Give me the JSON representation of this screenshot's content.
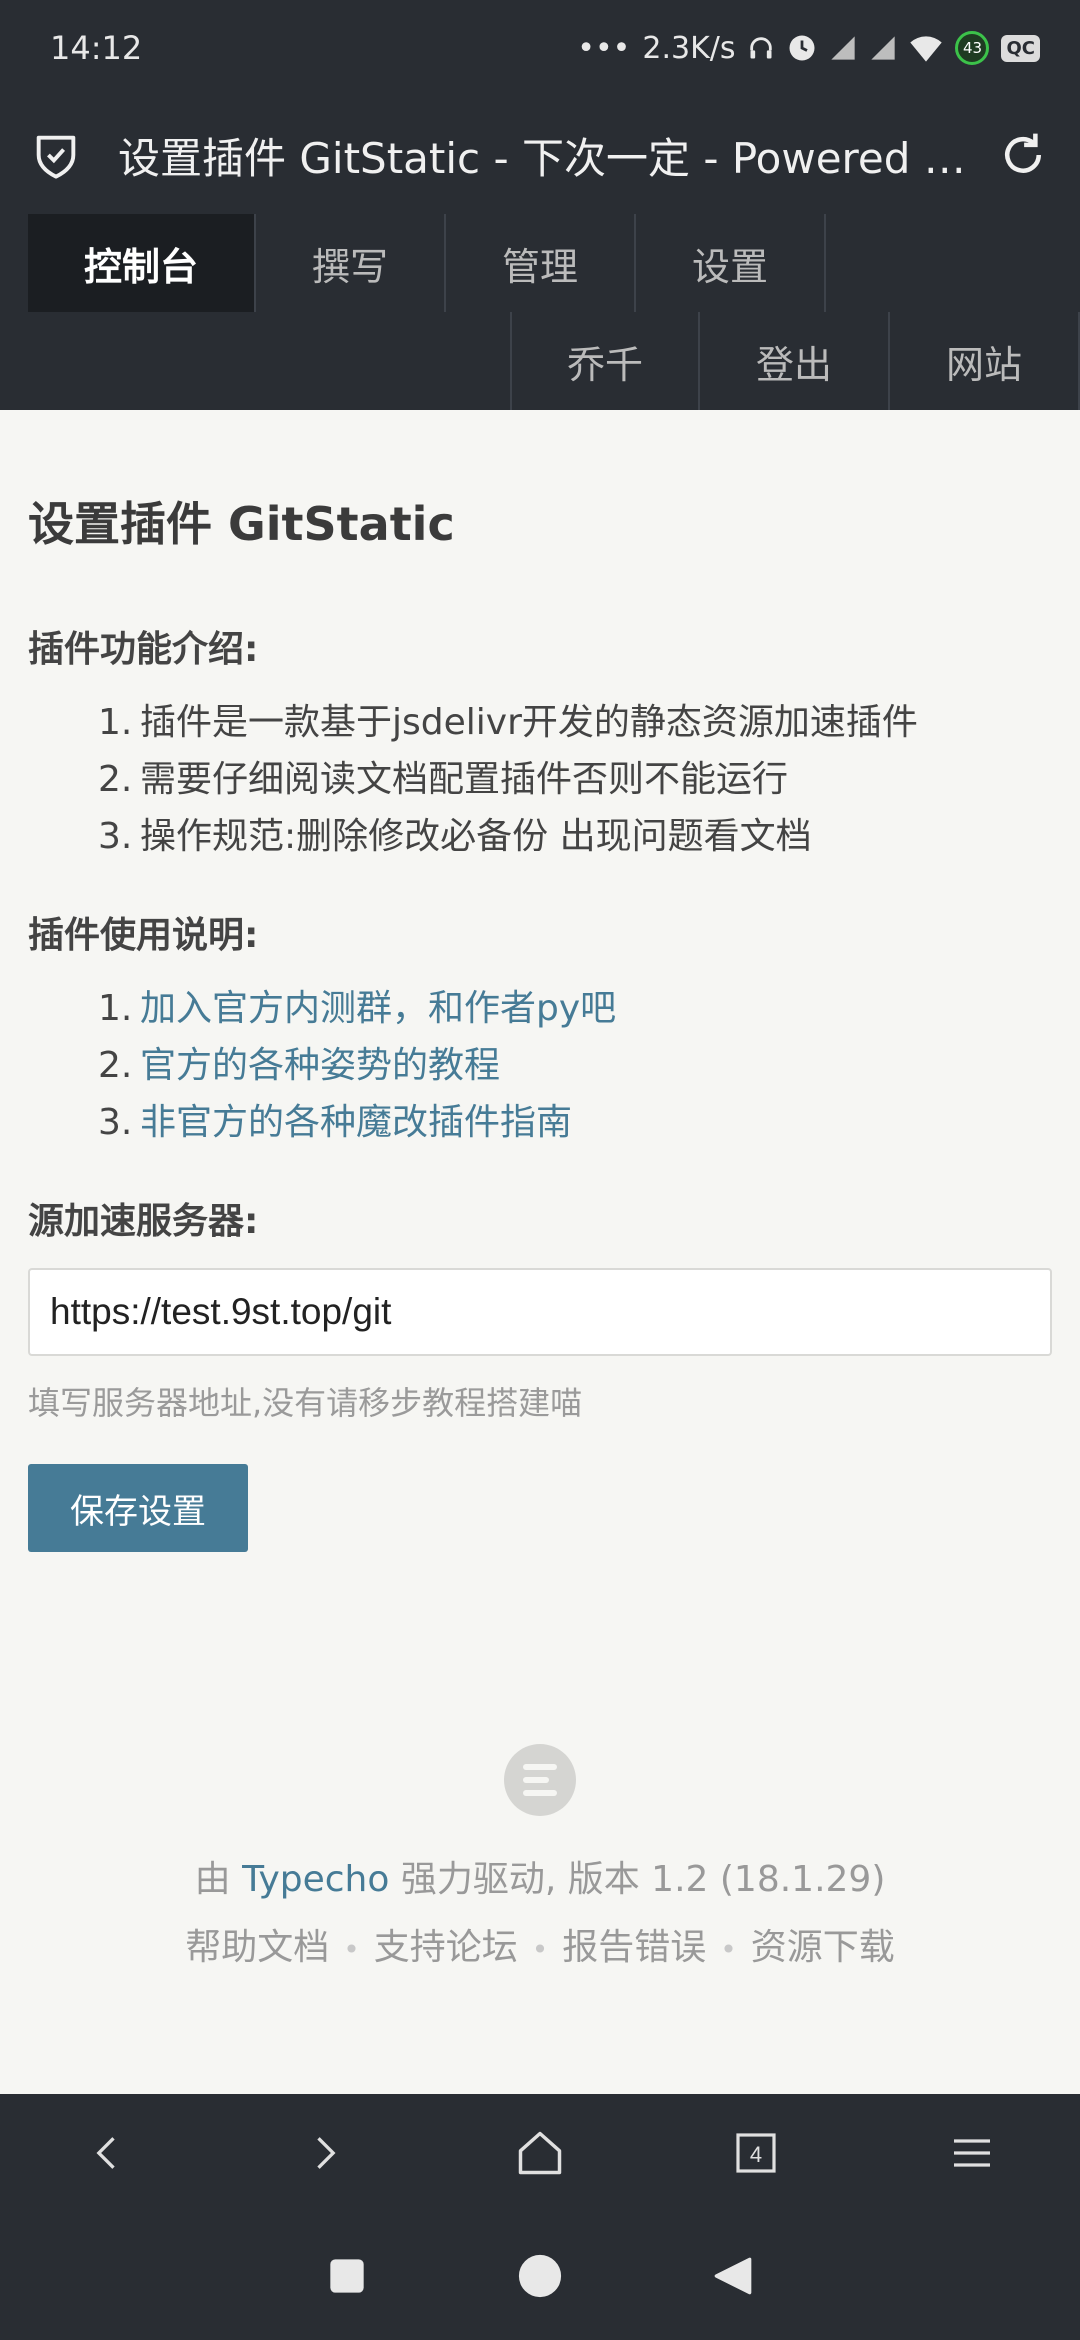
{
  "status_bar": {
    "time": "14:12",
    "network_speed": "2.3K/s",
    "battery_level": "43",
    "badge": "QC"
  },
  "title_bar": {
    "title": "设置插件 GitStatic - 下次一定 - Powered by Typecho"
  },
  "nav": {
    "row1": [
      {
        "label": "控制台",
        "active": true
      },
      {
        "label": "撰写",
        "active": false
      },
      {
        "label": "管理",
        "active": false
      },
      {
        "label": "设置",
        "active": false
      }
    ],
    "row2": [
      {
        "label": "乔千"
      },
      {
        "label": "登出"
      },
      {
        "label": "网站"
      }
    ]
  },
  "page": {
    "title": "设置插件 GitStatic",
    "intro_label": "插件功能介绍:",
    "intro_items": [
      "插件是一款基于jsdelivr开发的静态资源加速插件",
      "需要仔细阅读文档配置插件否则不能运行",
      "操作规范:删除修改必备份 出现问题看文档"
    ],
    "usage_label": "插件使用说明:",
    "usage_links": [
      "加入官方内测群，和作者py吧",
      "官方的各种姿势的教程",
      "非官方的各种魔改插件指南"
    ],
    "server_label": "源加速服务器:",
    "server_value": "https://test.9st.top/git",
    "server_desc": "填写服务器地址,没有请移步教程搭建喵",
    "save_label": "保存设置"
  },
  "footer": {
    "prefix": "由 ",
    "typecho": "Typecho",
    "suffix": " 强力驱动, 版本 1.2 (18.1.29)",
    "links": [
      "帮助文档",
      "支持论坛",
      "报告错误",
      "资源下载"
    ]
  },
  "browser_toolbar": {
    "tab_count": "4"
  },
  "colors": {
    "dark": "#292d33",
    "accent": "#467b96",
    "background": "#f6f6f3"
  }
}
